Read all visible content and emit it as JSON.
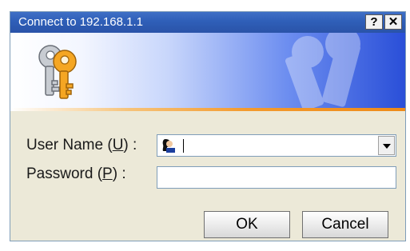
{
  "window": {
    "title": "Connect to 192.168.1.1",
    "help_label": "?",
    "close_label": "✕"
  },
  "form": {
    "username": {
      "label_before": "User Name (",
      "mnemonic": "U",
      "label_after": ") :",
      "value": ""
    },
    "password": {
      "label_before": "Password (",
      "mnemonic": "P",
      "label_after": ") :",
      "value": ""
    }
  },
  "buttons": {
    "ok": "OK",
    "cancel": "Cancel"
  },
  "icons": {
    "banner_left": "keys-icon",
    "banner_right": "keys-watermark-icon",
    "user_field": "user-icon",
    "dropdown": "chevron-down-icon"
  },
  "colors": {
    "titlebar": "#2f5fb8",
    "dialog_bg": "#ece9d8",
    "banner_accent": "#f39a2e"
  }
}
